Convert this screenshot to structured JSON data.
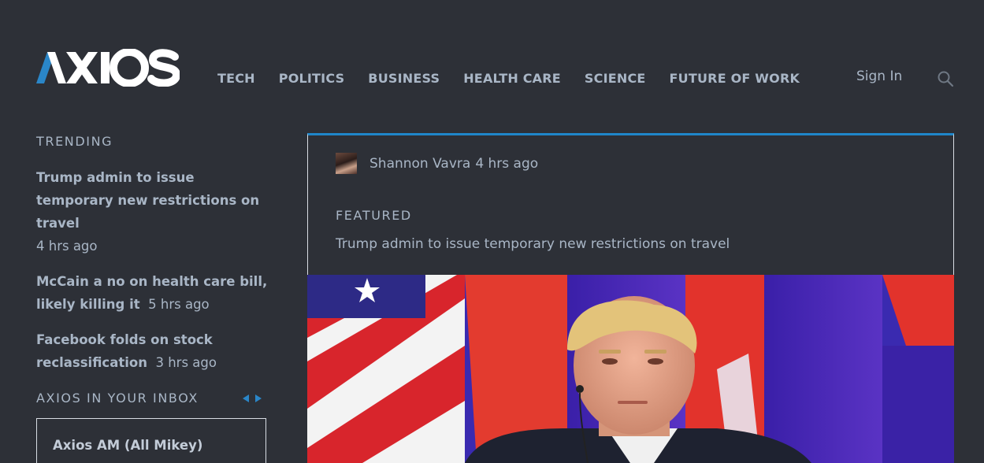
{
  "brand": {
    "name": "AXIOS"
  },
  "nav": {
    "items": [
      {
        "label": "TECH"
      },
      {
        "label": "POLITICS"
      },
      {
        "label": "BUSINESS"
      },
      {
        "label": "HEALTH CARE"
      },
      {
        "label": "SCIENCE"
      },
      {
        "label": "FUTURE OF WORK"
      }
    ],
    "sign_in": "Sign In",
    "search_icon": "search-icon"
  },
  "sidebar": {
    "trending_label": "TRENDING",
    "trending": [
      {
        "title": "Trump admin to issue temporary new restrictions on travel",
        "time": "4 hrs ago"
      },
      {
        "title": "McCain a no on health care bill, likely killing it",
        "time": "5 hrs ago"
      },
      {
        "title": "Facebook folds on stock reclassification",
        "time": "3 hrs ago"
      }
    ],
    "inbox_label": "AXIOS IN YOUR INBOX",
    "newsletter": {
      "name": "Axios AM (All Mikey)"
    }
  },
  "featured": {
    "author": "Shannon Vavra",
    "time": "4 hrs ago",
    "label": "FEATURED",
    "headline": "Trump admin to issue temporary new restrictions on travel"
  },
  "colors": {
    "background": "#2d3037",
    "text": "#a9b6c6",
    "accent": "#1f86c9",
    "logo_blue": "#2a86c8",
    "logo_white": "#ffffff"
  }
}
